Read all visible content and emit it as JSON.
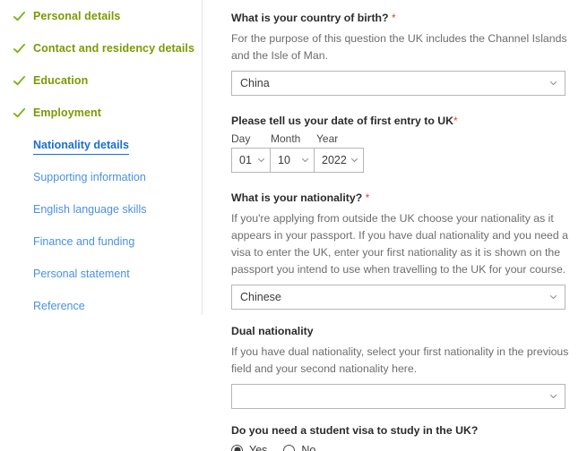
{
  "sidebar": {
    "items": [
      {
        "label": "Personal details",
        "state": "done",
        "icon": "check-icon"
      },
      {
        "label": "Contact and residency details",
        "state": "done",
        "icon": "check-icon"
      },
      {
        "label": "Education",
        "state": "done",
        "icon": "check-icon"
      },
      {
        "label": "Employment",
        "state": "done",
        "icon": "check-icon"
      },
      {
        "label": "Nationality details",
        "state": "active",
        "icon": ""
      },
      {
        "label": "Supporting information",
        "state": "link",
        "icon": ""
      },
      {
        "label": "English language skills",
        "state": "link",
        "icon": ""
      },
      {
        "label": "Finance and funding",
        "state": "link",
        "icon": ""
      },
      {
        "label": "Personal statement",
        "state": "link",
        "icon": ""
      },
      {
        "label": "Reference",
        "state": "link",
        "icon": ""
      }
    ]
  },
  "form": {
    "country_of_birth": {
      "label": "What is your country of birth?",
      "required_mark": "*",
      "help": "For the purpose of this question the UK includes the Channel Islands and the Isle of Man.",
      "value": "China",
      "chevron": "chevron-down-icon"
    },
    "first_entry_date": {
      "label": "Please tell us your date of first entry to UK",
      "required_mark": "*",
      "day_heading": "Day",
      "month_heading": "Month",
      "year_heading": "Year",
      "day_value": "01",
      "month_value": "10",
      "year_value": "2022"
    },
    "nationality": {
      "label": "What is your nationality?",
      "required_mark": "*",
      "help": "If you're applying from outside the UK choose your nationality as it appears in your passport. If you have dual nationality and you need a visa to enter the UK, enter your first nationality as it is shown on the passport you intend to use when travelling to the UK for your course.",
      "value": "Chinese"
    },
    "dual_nationality": {
      "label": "Dual nationality",
      "help": "If you have dual nationality, select your first nationality in the previous field and your second nationality here.",
      "value": ""
    },
    "student_visa": {
      "label": "Do you need a student visa to study in the UK?",
      "options": [
        {
          "label": "Yes",
          "selected": true
        },
        {
          "label": "No",
          "selected": false
        }
      ]
    }
  },
  "colors": {
    "completed_green": "#7a9a01",
    "check_green": "#7ab317",
    "link_blue": "#4a90e2",
    "active_blue": "#1a6fd4",
    "required_red": "#e8431f",
    "border_gray": "#b6b6b6",
    "help_text": "#6d6d6d"
  }
}
